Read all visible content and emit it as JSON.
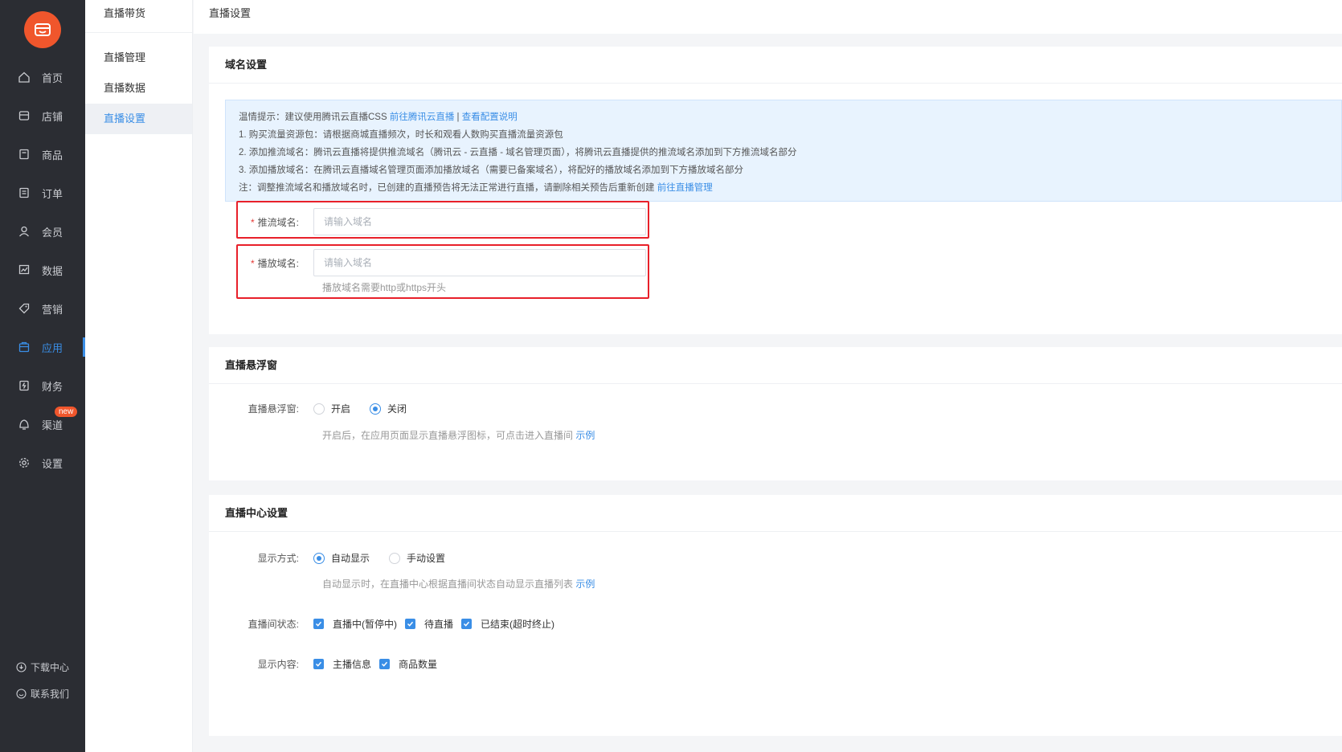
{
  "colors": {
    "accent": "#3a8ee6",
    "brand": "#f0562c",
    "sidebar_bg": "#2b2d33",
    "required": "#e53935",
    "highlight_box": "#e8202a"
  },
  "nav": {
    "logo_icon": "shop-logo-icon",
    "items": [
      {
        "label": "首页",
        "icon": "home-icon"
      },
      {
        "label": "店铺",
        "icon": "store-icon"
      },
      {
        "label": "商品",
        "icon": "goods-icon"
      },
      {
        "label": "订单",
        "icon": "order-icon"
      },
      {
        "label": "会员",
        "icon": "member-icon"
      },
      {
        "label": "数据",
        "icon": "data-chart-icon"
      },
      {
        "label": "营销",
        "icon": "tag-icon"
      },
      {
        "label": "应用",
        "icon": "app-bag-icon",
        "active": true
      },
      {
        "label": "财务",
        "icon": "finance-icon"
      },
      {
        "label": "渠道",
        "icon": "channel-icon",
        "badge": "new"
      },
      {
        "label": "设置",
        "icon": "gear-icon"
      }
    ],
    "footer": [
      {
        "label": "下载中心",
        "icon": "download-icon"
      },
      {
        "label": "联系我们",
        "icon": "contact-icon"
      }
    ]
  },
  "submenu": {
    "title": "直播带货",
    "items": [
      {
        "label": "直播管理"
      },
      {
        "label": "直播数据"
      },
      {
        "label": "直播设置",
        "active": true
      }
    ]
  },
  "header": {
    "title": "直播设置"
  },
  "domain_section": {
    "title": "域名设置",
    "tips": {
      "line1_prefix": "温情提示：建议使用腾讯云直播CSS ",
      "line1_link1": "前往腾讯云直播",
      "line1_sep": " | ",
      "line1_link2": "查看配置说明",
      "line2": "1. 购买流量资源包：请根据商城直播频次，时长和观看人数购买直播流量资源包",
      "line3": "2. 添加推流域名：腾讯云直播将提供推流域名（腾讯云 - 云直播 - 域名管理页面），将腾讯云直播提供的推流域名添加到下方推流域名部分",
      "line4": "3. 添加播放域名：在腾讯云直播域名管理页面添加播放域名（需要已备案域名），将配好的播放域名添加到下方播放域名部分",
      "line5_prefix": "注：调整推流域名和播放域名时，已创建的直播预告将无法正常进行直播，请删除相关预告后重新创建 ",
      "line5_link": "前往直播管理"
    },
    "push_label": "推流域名:",
    "push_placeholder": "请输入域名",
    "push_value": "",
    "play_label": "播放域名:",
    "play_placeholder": "请输入域名",
    "play_value": "",
    "play_help": "播放域名需要http或https开头",
    "required_mark": "*"
  },
  "float_section": {
    "title": "直播悬浮窗",
    "label": "直播悬浮窗:",
    "options": [
      {
        "label": "开启",
        "selected": false
      },
      {
        "label": "关闭",
        "selected": true
      }
    ],
    "help_prefix": "开启后，在应用页面显示直播悬浮图标，可点击进入直播间 ",
    "help_link": "示例"
  },
  "center_section": {
    "title": "直播中心设置",
    "display_label": "显示方式:",
    "display_options": [
      {
        "label": "自动显示",
        "selected": true
      },
      {
        "label": "手动设置",
        "selected": false
      }
    ],
    "display_help_prefix": "自动显示时，在直播中心根据直播间状态自动显示直播列表 ",
    "display_help_link": "示例",
    "status_label": "直播间状态:",
    "status_options": [
      {
        "label": "直播中(暂停中)",
        "checked": true
      },
      {
        "label": "待直播",
        "checked": true
      },
      {
        "label": "已结束(超时终止)",
        "checked": true
      }
    ],
    "content_label": "显示内容:",
    "content_options": [
      {
        "label": "主播信息",
        "checked": true
      },
      {
        "label": "商品数量",
        "checked": true
      }
    ]
  }
}
